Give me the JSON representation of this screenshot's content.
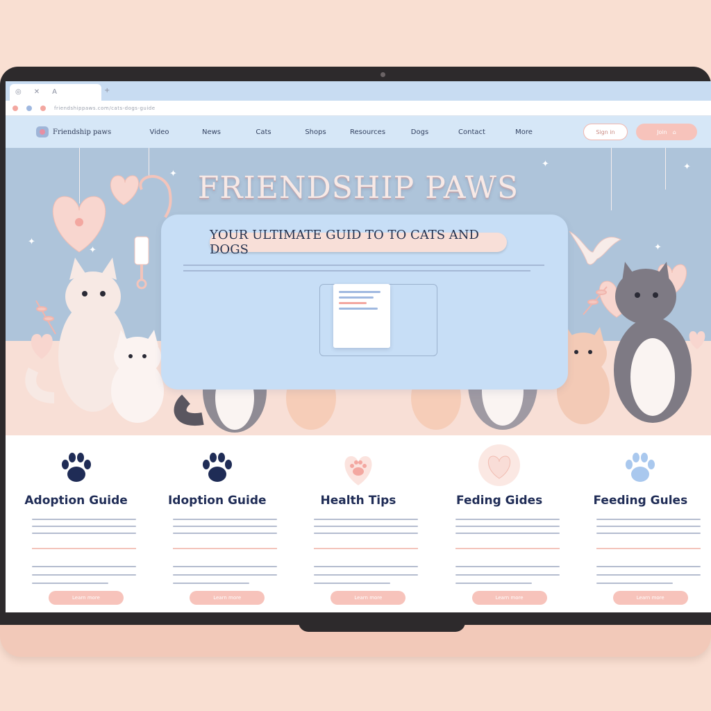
{
  "browser": {
    "url": "friendshippaws.com/cats-dogs-guide"
  },
  "site": {
    "brand": "Friendship paws",
    "nav": [
      "Video",
      "News",
      "Cats",
      "Shops",
      "Resources",
      "Dogs",
      "Contact",
      "More"
    ],
    "sign_in_label": "Sign in",
    "join_label": "Join"
  },
  "hero": {
    "title": "FRIENDSHIP PAWS",
    "tagline": "YOUR ULTIMATE GUID TO TO CATS AND DOGS"
  },
  "cards": [
    {
      "title": "Adoption Guide",
      "button": "Learn more",
      "icon": "paw-print-icon",
      "icon_color": "#1f2c56"
    },
    {
      "title": "Idoption Guide",
      "button": "Learn more",
      "icon": "paw-print-icon",
      "icon_color": "#1f2c56"
    },
    {
      "title": "Health Tips",
      "button": "Learn more",
      "icon": "paw-heart-icon",
      "icon_color": "#f7c3bb"
    },
    {
      "title": "Feding Gides",
      "button": "Learn more",
      "icon": "heart-icon",
      "icon_color": "#f9ddd7"
    },
    {
      "title": "Feeding Gules",
      "button": "Learn more",
      "icon": "paw-print-icon",
      "icon_color": "#a9c8ee"
    }
  ],
  "colors": {
    "accent_pink": "#f7c3bb",
    "navy": "#1f2c56",
    "hero_blue": "#aec4da",
    "panel_blue": "#c7def6"
  }
}
